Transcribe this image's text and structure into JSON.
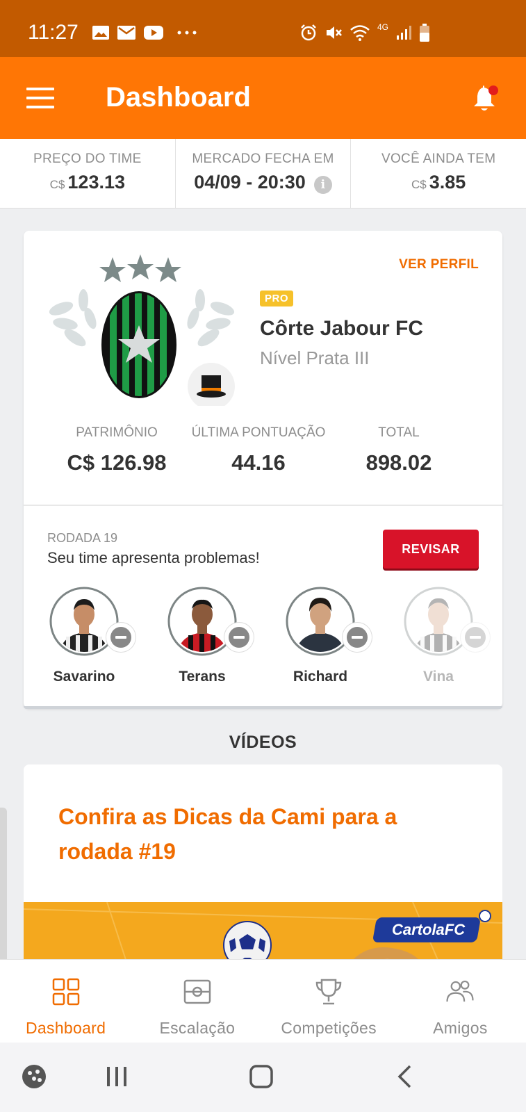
{
  "status_bar": {
    "time": "11:27",
    "left_icons": [
      "gallery-icon",
      "mail-icon",
      "youtube-icon",
      "more-icon"
    ],
    "right_icons": [
      "alarm-icon",
      "mute-icon",
      "wifi-icon",
      "4g-icon",
      "signal-icon",
      "battery-icon"
    ],
    "network_label": "4G"
  },
  "app_bar": {
    "title": "Dashboard",
    "menu_icon": "hamburger-menu-icon",
    "bell_icon": "notification-bell-icon",
    "accent": "#ff7605"
  },
  "info_bar": [
    {
      "label": "PREÇO DO TIME",
      "currency": "C$",
      "value": "123.13"
    },
    {
      "label": "MERCADO FECHA EM",
      "currency": "",
      "value": "04/09 - 20:30",
      "info_icon": "i"
    },
    {
      "label": "VOCÊ AINDA TEM",
      "currency": "C$",
      "value": "3.85"
    }
  ],
  "team_card": {
    "ver_perfil": "VER PERFIL",
    "pro_badge": "PRO",
    "team_name": "Côrte Jabour FC",
    "level": "Nível Prata III",
    "stars": 3,
    "stats": [
      {
        "label": "PATRIMÔNIO",
        "value": "C$ 126.98"
      },
      {
        "label": "ÚLTIMA PONTUAÇÃO",
        "value": "44.16"
      },
      {
        "label": "TOTAL",
        "value": "898.02"
      }
    ],
    "round_label": "RODADA 19",
    "round_message": "Seu time apresenta problemas!",
    "revisar_button": "REVISAR",
    "players": [
      {
        "name": "Savarino",
        "kit": "striped"
      },
      {
        "name": "Terans",
        "kit": "red-black"
      },
      {
        "name": "Richard",
        "kit": "dark"
      },
      {
        "name": "Vina",
        "kit": "striped"
      }
    ]
  },
  "videos": {
    "section_title": "VÍDEOS",
    "video_title": "Confira as Dicas da Cami para a rodada #19",
    "thumb_brand": "CartolaFC"
  },
  "bottom_nav": [
    {
      "label": "Dashboard",
      "icon": "dashboard-grid-icon",
      "active": true
    },
    {
      "label": "Escalação",
      "icon": "field-icon",
      "active": false
    },
    {
      "label": "Competições",
      "icon": "trophy-icon",
      "active": false
    },
    {
      "label": "Amigos",
      "icon": "friends-icon",
      "active": false
    }
  ],
  "system_nav": [
    "game-launcher-icon",
    "recents-icon",
    "home-icon",
    "back-icon"
  ]
}
